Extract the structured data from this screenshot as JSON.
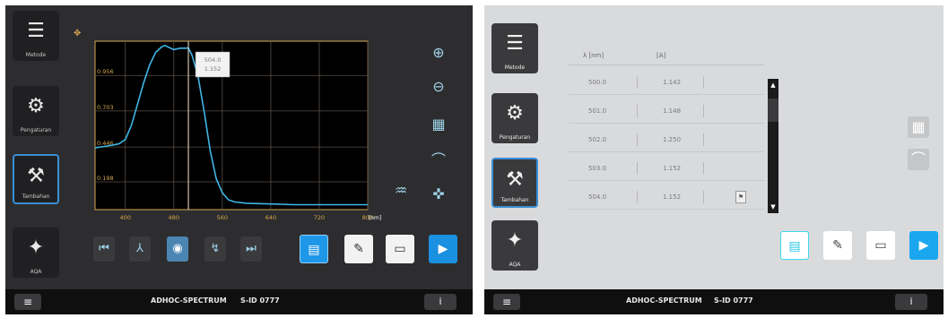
{
  "left_screen": {
    "sidebar": [
      {
        "label": "Metode",
        "icon": "list-icon"
      },
      {
        "label": "Pengaturan",
        "icon": "gear-icon"
      },
      {
        "label": "Tambahan",
        "icon": "tools-icon"
      },
      {
        "label": "AQA",
        "icon": "aqa-icon"
      }
    ],
    "tooltip": [
      "504.0",
      "1.152"
    ],
    "axis_unit": "[nm]",
    "bottom_bar": {
      "title": "ADHOC-SPECTRUM",
      "id": "S-ID 0777",
      "menu_icon": "≡",
      "info_icon": "i"
    }
  },
  "right_screen": {
    "sidebar": [
      {
        "label": "Metode",
        "icon": "list-icon"
      },
      {
        "label": "Pengaturan",
        "icon": "gear-icon"
      },
      {
        "label": "Tambahan",
        "icon": "tools-icon"
      },
      {
        "label": "AQA",
        "icon": "aqa-icon"
      }
    ],
    "table": {
      "headers": [
        "λ [nm]",
        "[A]"
      ],
      "rows": [
        [
          "500.0",
          "1.142"
        ],
        [
          "501.0",
          "1.148"
        ],
        [
          "502.0",
          "1.250"
        ],
        [
          "503.0",
          "1.152"
        ],
        [
          "504.0",
          "1.152"
        ]
      ]
    },
    "bottom_bar": {
      "title": "ADHOC-SPECTRUM",
      "id": "S-ID 0777",
      "menu_icon": "≡",
      "info_icon": "i"
    }
  },
  "chart_data": {
    "type": "line",
    "xlabel": "[nm]",
    "ylabel": "",
    "x_ticks": [
      "400",
      "480",
      "560",
      "640",
      "720",
      "800"
    ],
    "y_ticks": [
      "0.198",
      "0.446",
      "0.703",
      "0.956"
    ],
    "xlim": [
      350,
      800
    ],
    "ylim": [
      0.0,
      1.2
    ],
    "series": [
      {
        "x": [
          350,
          365,
          380,
          390,
          400,
          410,
          420,
          430,
          440,
          450,
          460,
          465,
          470,
          480,
          490,
          500,
          504,
          510,
          520,
          530,
          540,
          550,
          560,
          570,
          580,
          600,
          640,
          680,
          720,
          760,
          800
        ],
        "y": [
          0.44,
          0.45,
          0.46,
          0.47,
          0.5,
          0.6,
          0.75,
          0.9,
          1.03,
          1.12,
          1.16,
          1.17,
          1.16,
          1.14,
          1.15,
          1.15,
          1.152,
          1.1,
          0.95,
          0.7,
          0.42,
          0.22,
          0.12,
          0.07,
          0.055,
          0.045,
          0.04,
          0.035,
          0.035,
          0.035,
          0.035
        ],
        "color": "#3fb6e6"
      }
    ],
    "grid": true,
    "cursor_x": 504
  }
}
